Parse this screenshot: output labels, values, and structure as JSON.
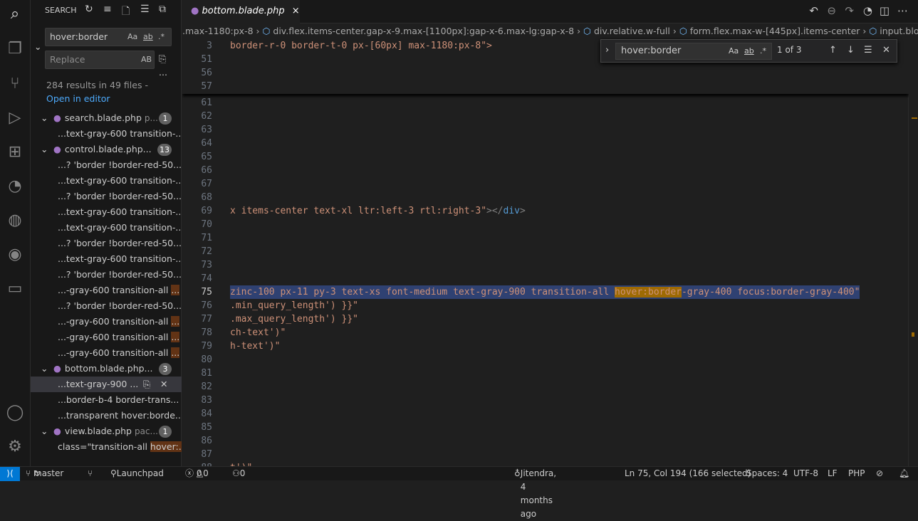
{
  "activity": [
    "search-icon",
    "files-icon",
    "source-control-icon",
    "run-debug-icon",
    "extensions-icon",
    "git-graph-icon",
    "pull-request-icon",
    "github-icon",
    "comments-icon",
    "account-icon",
    "gear-icon"
  ],
  "search": {
    "title": "SEARCH",
    "query": "hover:border",
    "replace_placeholder": "Replace",
    "opt_case": "Aa",
    "opt_word": "ab",
    "opt_regex": ".*",
    "opt_preserve": "AB",
    "results": "284 results in 49 files - ",
    "open_editor": "Open in editor",
    "more": "..."
  },
  "files": [
    {
      "name": "search.blade.php",
      "dir": "p...",
      "count": "1",
      "matches": [
        {
          "pre": "...text-gray-600 transition-...",
          "hl": ""
        }
      ]
    },
    {
      "name": "control.blade.php...",
      "dir": "",
      "count": "13",
      "matches": [
        {
          "pre": "...? 'border !border-red-50...",
          "hl": " "
        },
        {
          "pre": "...text-gray-600 transition-...",
          "hl": ""
        },
        {
          "pre": "...? 'border !border-red-50...",
          "hl": " "
        },
        {
          "pre": "...text-gray-600 transition-...",
          "hl": ""
        },
        {
          "pre": "...text-gray-600 transition-...",
          "hl": ""
        },
        {
          "pre": "...? 'border !border-red-50...",
          "hl": " "
        },
        {
          "pre": "...text-gray-600 transition-...",
          "hl": ""
        },
        {
          "pre": "...? 'border !border-red-50...",
          "hl": " "
        },
        {
          "pre": "...-gray-600  transition-all ",
          "hl": "..."
        },
        {
          "pre": "...? 'border !border-red-50...",
          "hl": " "
        },
        {
          "pre": "...-gray-600  transition-all ",
          "hl": "..."
        },
        {
          "pre": "...-gray-600  transition-all ",
          "hl": "..."
        },
        {
          "pre": "...-gray-600  transition-all ",
          "hl": "..."
        }
      ]
    },
    {
      "name": "bottom.blade.php...",
      "dir": "",
      "count": "3",
      "matches": [
        {
          "pre": "...text-gray-900 ...",
          "hl": "",
          "selected": true
        },
        {
          "pre": "...border-b-4 border-trans...",
          "hl": ""
        },
        {
          "pre": "...transparent hover:borde...",
          "hl": ""
        }
      ]
    },
    {
      "name": "view.blade.php",
      "dir": "pac...",
      "count": "1",
      "matches": [
        {
          "pre": "class=\"transition-all ",
          "hl": "hover:..."
        }
      ]
    }
  ],
  "tab": {
    "label": "bottom.blade.php",
    "close": "×"
  },
  "breadcrumb": [
    ".max-1180:px-8",
    "div.flex.items-center.gap-x-9.max-[1100px]:gap-x-6.max-lg:gap-x-8",
    "div.relative.w-full",
    "form.flex.max-w-[445px].items-center",
    "input.block.w-full"
  ],
  "sticky": [
    {
      "n": "3",
      "t": "border-r-0 border-t-0 px-[60px] max-1180:px-8\">"
    },
    {
      "n": "51",
      "t": ""
    },
    {
      "n": "56",
      "t": ""
    },
    {
      "n": "57",
      "t": ""
    }
  ],
  "lines": [
    {
      "n": "61",
      "t": ""
    },
    {
      "n": "62",
      "t": ""
    },
    {
      "n": "63",
      "t": ""
    },
    {
      "n": "64",
      "t": ""
    },
    {
      "n": "65",
      "t": ""
    },
    {
      "n": "66",
      "t": ""
    },
    {
      "n": "67",
      "t": ""
    },
    {
      "n": "68",
      "t": ""
    },
    {
      "n": "69",
      "t": "x items-center text-xl ltr:left-3 rtl:right-3\"",
      "tag": "></",
      "tn": "div",
      "tag2": ">"
    },
    {
      "n": "70",
      "t": ""
    },
    {
      "n": "71",
      "t": ""
    },
    {
      "n": "72",
      "t": ""
    },
    {
      "n": "73",
      "t": ""
    },
    {
      "n": "74",
      "t": ""
    },
    {
      "n": "75",
      "t": "zinc-100 px-11 py-3 text-xs font-medium text-gray-900 transition-all ",
      "hl": "hover:border",
      "t2": "-gray-400 focus:border-gray-400\"",
      "current": true
    },
    {
      "n": "76",
      "t": ".min_query_length') }}\""
    },
    {
      "n": "77",
      "t": ".max_query_length') }}\""
    },
    {
      "n": "78",
      "t": "ch-text')\""
    },
    {
      "n": "79",
      "t": "h-text')\""
    },
    {
      "n": "80",
      "t": ""
    },
    {
      "n": "81",
      "t": ""
    },
    {
      "n": "82",
      "t": ""
    },
    {
      "n": "83",
      "t": ""
    },
    {
      "n": "84",
      "t": ""
    },
    {
      "n": "85",
      "t": ""
    },
    {
      "n": "86",
      "t": ""
    },
    {
      "n": "87",
      "t": ""
    },
    {
      "n": "88",
      "t": "t')\""
    }
  ],
  "find": {
    "query": "hover:border",
    "case": "Aa",
    "word": "ab",
    "regex": ".*",
    "count": "1 of 3"
  },
  "status": {
    "branch": "master",
    "launchpad": "Launchpad",
    "errors": "0",
    "warnings": "0",
    "ports": "0",
    "blame": "Jitendra, 4 months ago",
    "position": "Ln 75, Col 194 (166 selected)",
    "spaces": "Spaces: 4",
    "encoding": "UTF-8",
    "eol": "LF",
    "language": "PHP"
  },
  "colors": {
    "accent": "#0078d4",
    "string": "#ce9178",
    "match": "#9e6a03",
    "selection": "#2f4172"
  }
}
